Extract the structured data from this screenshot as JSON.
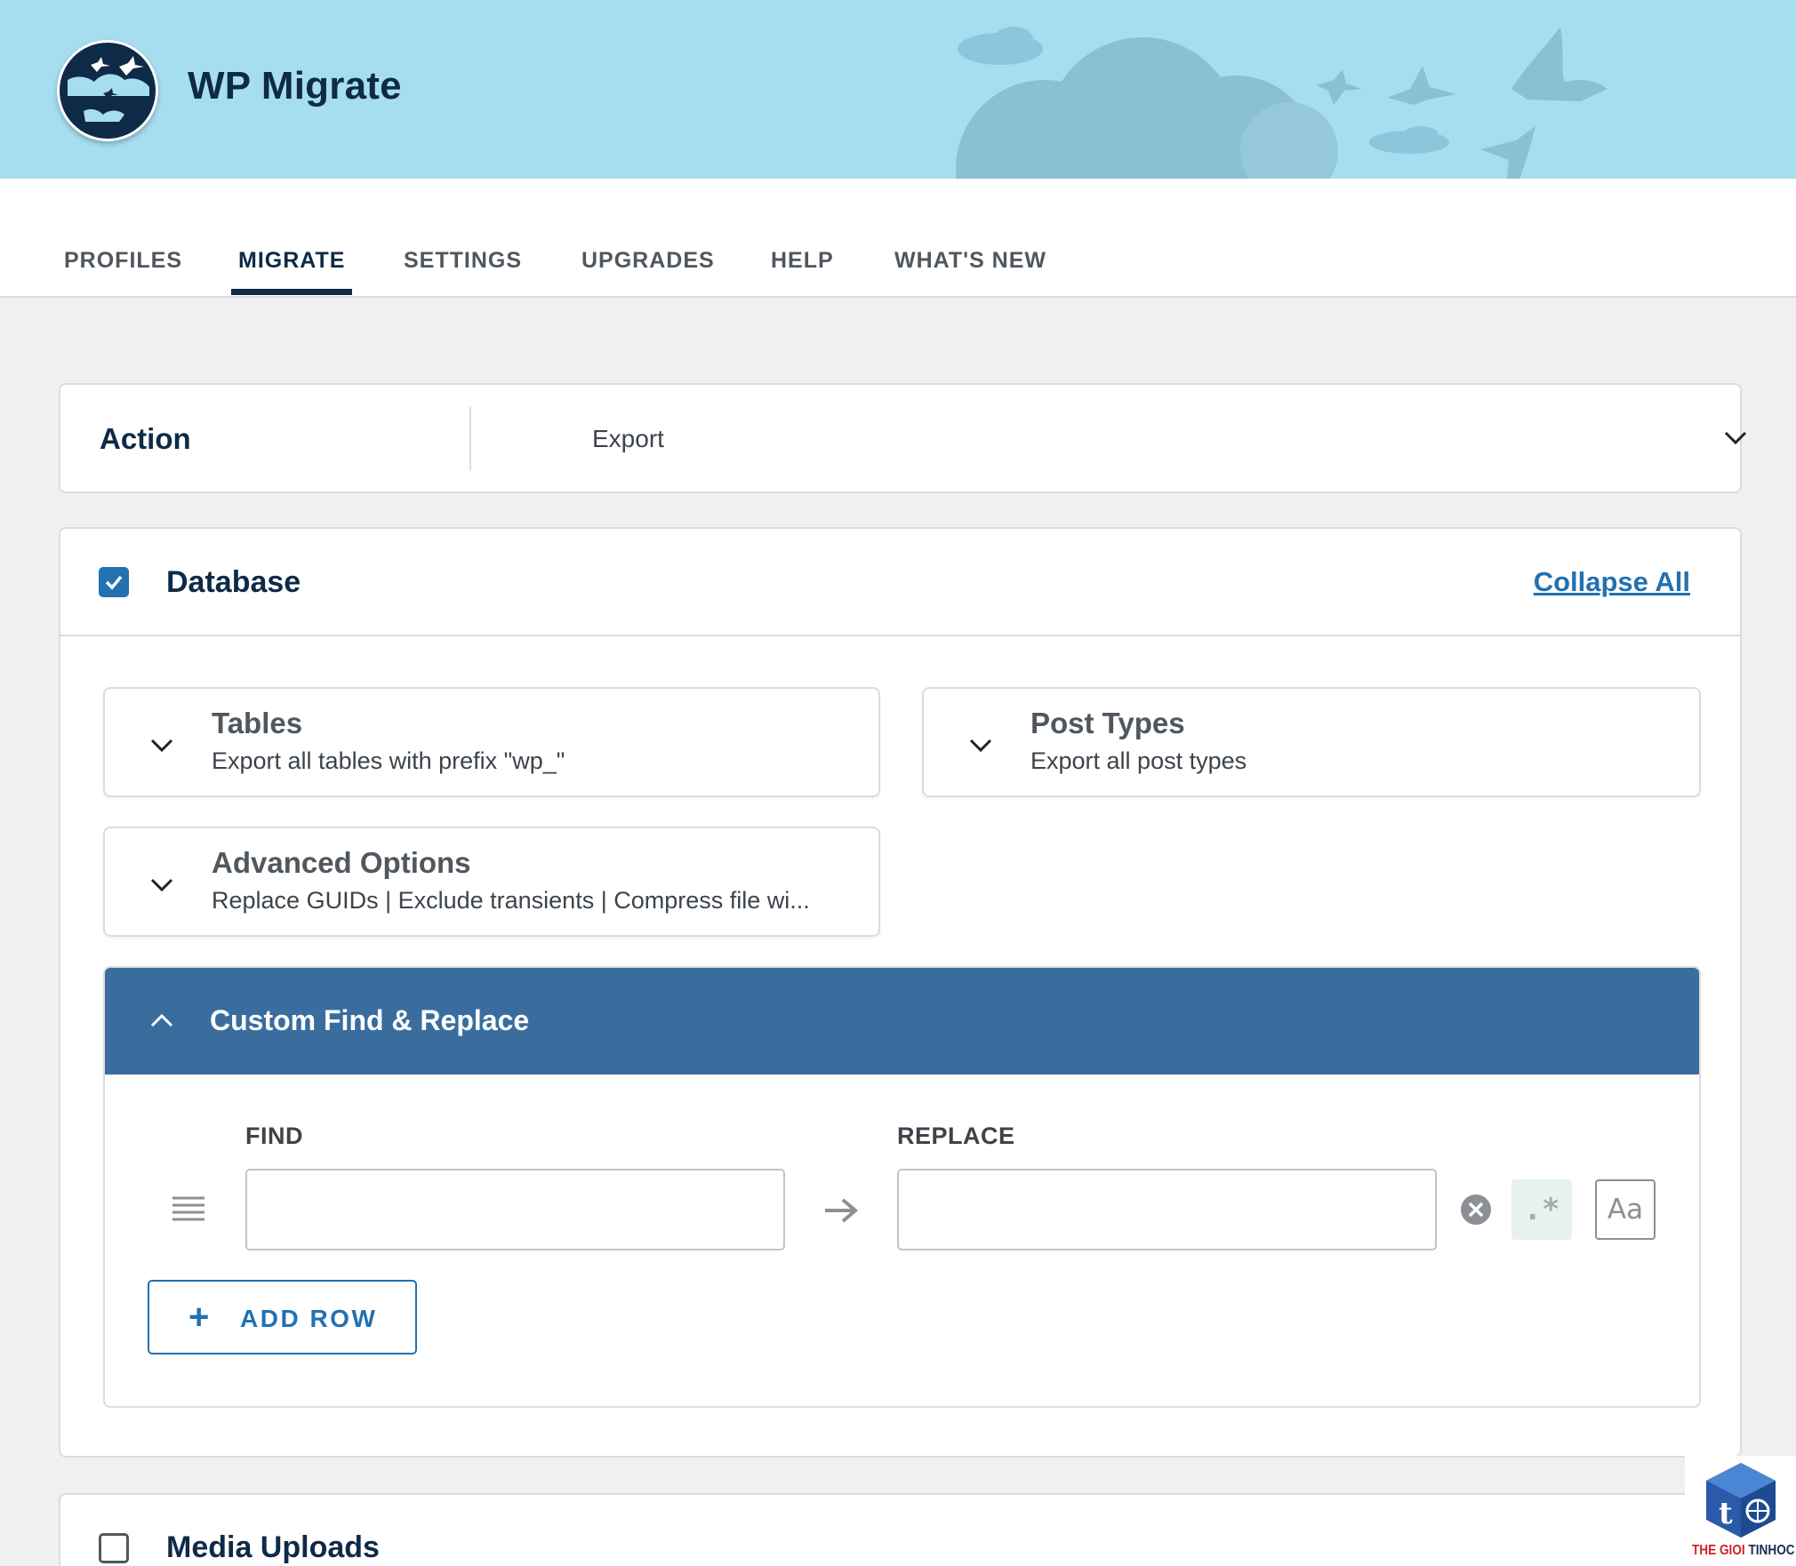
{
  "header": {
    "app_title": "WP Migrate",
    "logo_icon": "wp-migrate-logo-birds",
    "banner_color": "#a6deef"
  },
  "nav": {
    "tabs": [
      {
        "label": "PROFILES",
        "active": false
      },
      {
        "label": "MIGRATE",
        "active": true
      },
      {
        "label": "SETTINGS",
        "active": false
      },
      {
        "label": "UPGRADES",
        "active": false
      },
      {
        "label": "HELP",
        "active": false
      },
      {
        "label": "WHAT'S NEW",
        "active": false
      }
    ]
  },
  "action": {
    "label": "Action",
    "selected": "Export",
    "icon": "chevron-down-icon"
  },
  "database": {
    "checked": true,
    "title": "Database",
    "collapse_all": "Collapse All",
    "cards": [
      {
        "title": "Tables",
        "subtitle": "Export all tables with prefix \"wp_\"",
        "icon": "chevron-down-icon"
      },
      {
        "title": "Post Types",
        "subtitle": "Export all post types",
        "icon": "chevron-down-icon"
      },
      {
        "title": "Advanced Options",
        "subtitle": "Replace GUIDs | Exclude transients | Compress file wi...",
        "icon": "chevron-down-icon"
      }
    ],
    "find_replace": {
      "title": "Custom Find & Replace",
      "icon": "chevron-up-icon",
      "header_color": "#3a6d9e",
      "find_label": "FIND",
      "replace_label": "REPLACE",
      "find_value": "",
      "replace_value": "",
      "regex_label": ".*",
      "case_label": "Aa",
      "add_row_plus": "+",
      "add_row_label": "ADD ROW"
    }
  },
  "media": {
    "checked": false,
    "title": "Media Uploads"
  },
  "watermark": {
    "part1": "THE GIOI ",
    "part2": "TINHOC",
    "icon": "thegioitinhoc-cube-logo"
  },
  "colors": {
    "accent": "#2271b1",
    "navy": "#0f2a47"
  }
}
